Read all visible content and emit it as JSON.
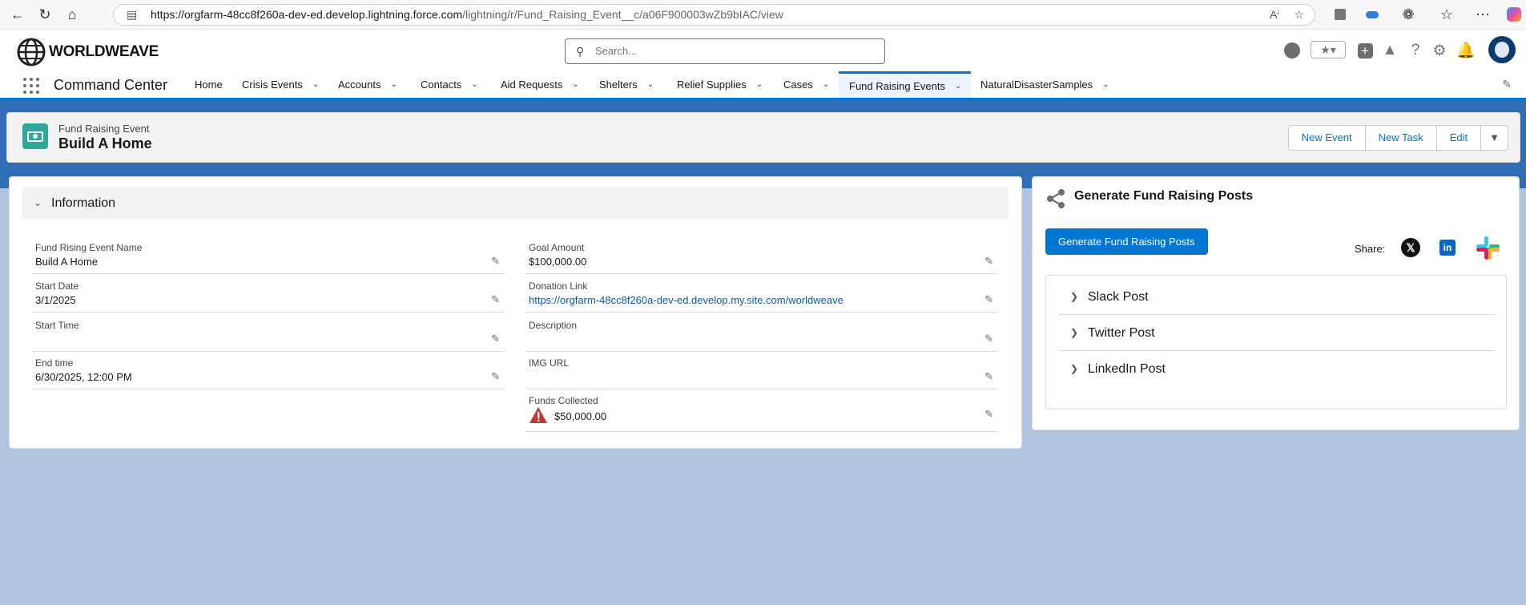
{
  "browser": {
    "url_host": "https://orgfarm-48cc8f260a-dev-ed.develop.lightning.force.com",
    "url_path": "/lightning/r/Fund_Raising_Event__c/a06F900003wZb9bIAC/view"
  },
  "header": {
    "brand": "WORLDWEAVE",
    "search_placeholder": "Search..."
  },
  "nav": {
    "app_name": "Command Center",
    "tabs": [
      {
        "label": "Home",
        "dropdown": false
      },
      {
        "label": "Crisis Events",
        "dropdown": true
      },
      {
        "label": "Accounts",
        "dropdown": true
      },
      {
        "label": "Contacts",
        "dropdown": true
      },
      {
        "label": "Aid Requests",
        "dropdown": true
      },
      {
        "label": "Shelters",
        "dropdown": true
      },
      {
        "label": "Relief Supplies",
        "dropdown": true
      },
      {
        "label": "Cases",
        "dropdown": true
      },
      {
        "label": "Fund Raising Events",
        "dropdown": true,
        "active": true
      },
      {
        "label": "NaturalDisasterSamples",
        "dropdown": true
      }
    ]
  },
  "record": {
    "object_type": "Fund Raising Event",
    "title": "Build A Home",
    "actions": [
      "New Event",
      "New Task",
      "Edit"
    ]
  },
  "details": {
    "section_title": "Information",
    "left_fields": [
      {
        "label": "Fund Rising Event Name",
        "value": "Build A Home"
      },
      {
        "label": "Start Date",
        "value": "3/1/2025"
      },
      {
        "label": "Start Time",
        "value": ""
      },
      {
        "label": "End time",
        "value": "6/30/2025, 12:00 PM"
      }
    ],
    "right_fields": [
      {
        "label": "Goal Amount",
        "value": "$100,000.00"
      },
      {
        "label": "Donation Link",
        "value": "https://orgfarm-48cc8f260a-dev-ed.develop.my.site.com/worldweave"
      },
      {
        "label": "Description",
        "value": ""
      },
      {
        "label": "IMG URL",
        "value": ""
      },
      {
        "label": "Funds Collected",
        "value": "$50,000.00"
      }
    ]
  },
  "side": {
    "title": "Generate Fund Raising Posts",
    "button_label": "Generate Fund Raising Posts",
    "share_label": "Share:",
    "share_icons": [
      "x-icon",
      "linkedin-icon",
      "slack-icon"
    ],
    "posts": [
      "Slack Post",
      "Twitter Post",
      "LinkedIn Post"
    ]
  },
  "colors": {
    "brand_blue": "#0176d3",
    "page_background": "#b0c4df",
    "record_icon": "#2fa89a"
  }
}
